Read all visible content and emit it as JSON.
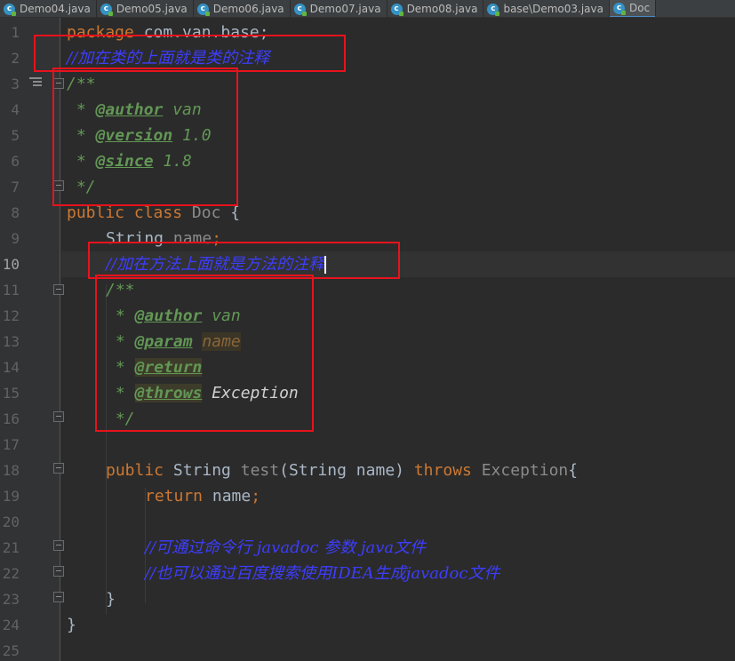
{
  "tabs": [
    {
      "label": "Demo04.java",
      "icon": "java-class-icon",
      "active": false
    },
    {
      "label": "Demo05.java",
      "icon": "java-class-icon",
      "active": false
    },
    {
      "label": "Demo06.java",
      "icon": "java-class-icon",
      "active": false
    },
    {
      "label": "Demo07.java",
      "icon": "java-class-icon",
      "active": false
    },
    {
      "label": "Demo08.java",
      "icon": "java-class-icon",
      "active": false
    },
    {
      "label": "base\\Demo03.java",
      "icon": "java-class-icon",
      "active": false
    },
    {
      "label": "Doc",
      "icon": "java-class-icon",
      "active": true
    }
  ],
  "line_numbers": [
    "1",
    "2",
    "3",
    "4",
    "5",
    "6",
    "7",
    "8",
    "9",
    "10",
    "11",
    "12",
    "13",
    "14",
    "15",
    "16",
    "17",
    "18",
    "19",
    "20",
    "21",
    "22",
    "23",
    "24",
    "25"
  ],
  "current_line": "10",
  "code": {
    "l1_kw": "package",
    "l1_rest": " com.van.base;",
    "l2_comment": "//加在类的上面就是类的注释",
    "l3": "/**",
    "l4_star": " * ",
    "l4_tag": "@author",
    "l4_val": " van",
    "l5_star": " * ",
    "l5_tag": "@version",
    "l5_val": " 1.0",
    "l6_star": " * ",
    "l6_tag": "@since",
    "l6_val": " 1.8",
    "l7": " */",
    "l8_kw1": "public",
    "l8_kw2": "class",
    "l8_name": "Doc",
    "l8_brace": " {",
    "l9_type": "String",
    "l9_field": "name",
    "l9_semi": ";",
    "l10_comment": "//加在方法上面就是方法的注释",
    "l11": "/**",
    "l12_star": " * ",
    "l12_tag": "@author",
    "l12_val": " van",
    "l13_star": " * ",
    "l13_tag": "@param",
    "l13_val": "name",
    "l14_star": " * ",
    "l14_tag": "@return",
    "l15_star": " * ",
    "l15_tag": "@throws",
    "l15_val": " Exception",
    "l16": " */",
    "l18_kw1": "public",
    "l18_type": "String",
    "l18_method": "test",
    "l18_params": "(String name)",
    "l18_kw2": "throws",
    "l18_ex": "Exception",
    "l18_brace": "{",
    "l19_kw": "return",
    "l19_val": " name",
    "l19_semi": ";",
    "l21_comment": "//可通过命令行 javadoc 参数 java文件",
    "l22_comment": "//也可以通过百度搜索使用IDEA生成javadoc文件",
    "l23": "}",
    "l24": "}"
  },
  "colors": {
    "annotation_box": "#e8121c",
    "keyword": "#cc7832",
    "doc_comment": "#629755",
    "line_comment": "#3d3dff",
    "background": "#2b2b2b"
  }
}
